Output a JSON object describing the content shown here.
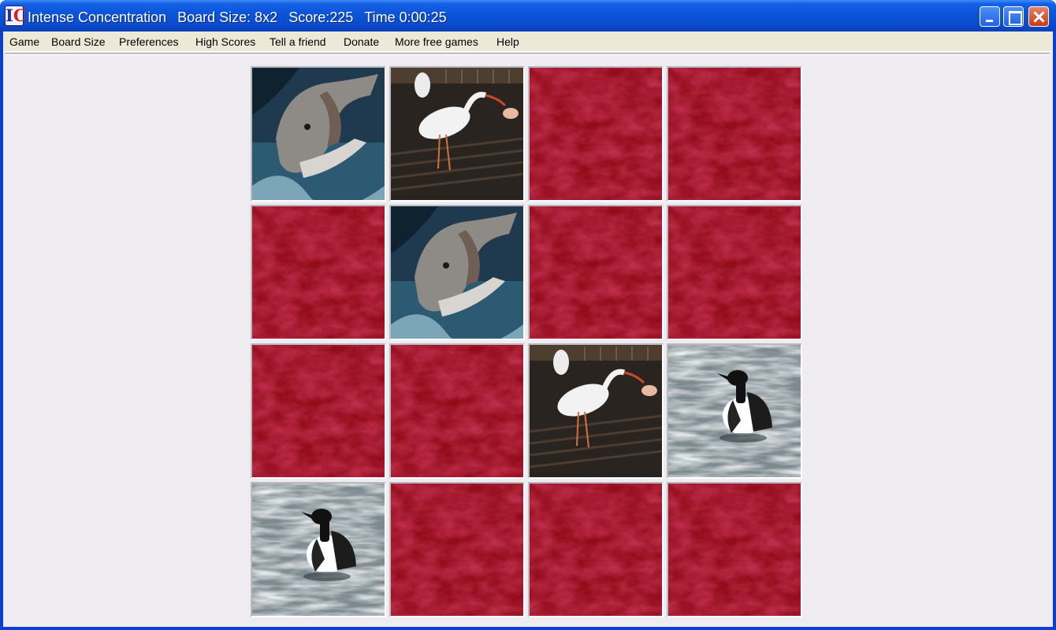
{
  "window": {
    "app_title": "Intense Concentration",
    "board_size_label": "Board Size: 8x2",
    "score_label": "Score:225",
    "time_label": "Time 0:00:25",
    "controls": [
      "minimize-icon",
      "maximize-icon",
      "close-icon"
    ]
  },
  "menu": {
    "items": [
      "Game",
      "Board Size",
      "Preferences",
      "High Scores",
      "Tell a friend",
      "Donate",
      "More free games",
      "Help"
    ]
  },
  "board": {
    "rows": 4,
    "cols": 4,
    "card_back": "red-texture",
    "card_back_color": "#a3101c",
    "tiles": [
      [
        "dolphin",
        "ibis",
        "back",
        "back"
      ],
      [
        "back",
        "dolphin",
        "back",
        "back"
      ],
      [
        "back",
        "back",
        "ibis",
        "loon"
      ],
      [
        "loon",
        "back",
        "back",
        "back"
      ]
    ]
  }
}
